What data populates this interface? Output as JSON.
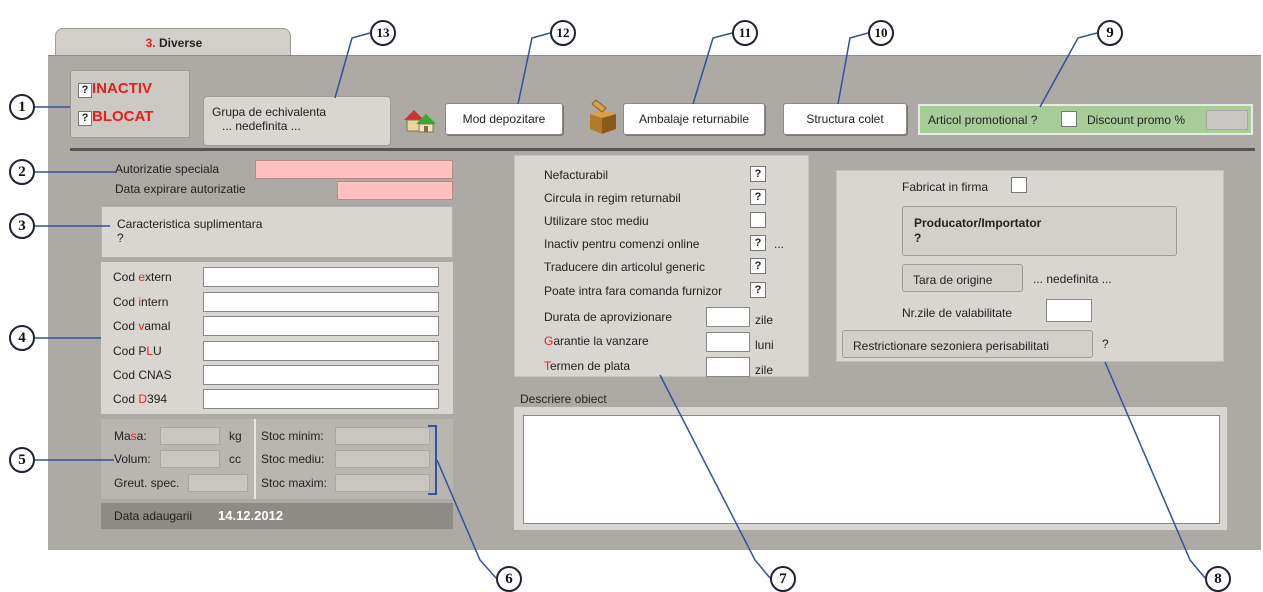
{
  "tab": {
    "num": "3.",
    "label": "Diverse"
  },
  "status": {
    "inactiv": "INACTIV",
    "blocat": "BLOCAT",
    "q": "?"
  },
  "grupa": {
    "line1": "Grupa de echivalenta",
    "line2": "... nedefinita ..."
  },
  "buttons": {
    "mod_depozitare": "Mod depozitare",
    "ambalaje": "Ambalaje returnabile",
    "structura": "Structura colet"
  },
  "promo": {
    "articol": "Articol promotional ?",
    "discount": "Discount promo %"
  },
  "autorizatie": {
    "speciala": "Autorizatie speciala",
    "data_expirare": "Data expirare autorizatie"
  },
  "caracteristica": {
    "label": "Caracteristica suplimentara",
    "value": "?"
  },
  "coduri": [
    {
      "pre": "Cod ",
      "red": "e",
      "post": "xtern"
    },
    {
      "pre": "Cod ",
      "red": "i",
      "post": "ntern"
    },
    {
      "pre": "Cod ",
      "red": "v",
      "post": "amal"
    },
    {
      "pre": "Cod P",
      "red": "L",
      "post": "U"
    },
    {
      "pre": "Cod CNAS",
      "red": "",
      "post": ""
    },
    {
      "pre": "Cod ",
      "red": "D",
      "post": "394"
    }
  ],
  "fizice": {
    "masa_pre": "Ma",
    "masa_red": "s",
    "masa_post": "a:",
    "kg": "kg",
    "volum": "Volum:",
    "cc": "cc",
    "greut": "Greut. spec."
  },
  "stoc": {
    "minim": "Stoc minim:",
    "mediu": "Stoc mediu:",
    "maxim": "Stoc maxim:"
  },
  "data_adaugarii": {
    "label": "Data adaugarii",
    "value": "14.12.2012"
  },
  "flags": [
    {
      "label": "Nefacturabil",
      "mark": "?"
    },
    {
      "label": "Circula in regim returnabil",
      "mark": "?"
    },
    {
      "label": "Utilizare stoc mediu",
      "mark": ""
    },
    {
      "label": "Inactiv pentru comenzi online",
      "mark": "?",
      "extra": "..."
    },
    {
      "label": "Traducere din articolul generic",
      "mark": "?"
    },
    {
      "label": "Poate intra fara comanda furnizor",
      "mark": "?"
    }
  ],
  "durate": {
    "aprov": "Durata de aprovizionare",
    "aprov_unit": "zile",
    "garantie_red": "G",
    "garantie": "arantie la vanzare",
    "garantie_unit": "luni",
    "termen_red": "T",
    "termen": "ermen de plata",
    "termen_unit": "zile"
  },
  "right": {
    "fabricat": "Fabricat in firma",
    "producator": "Producator/Importator",
    "producator_q": "?",
    "tara": "Tara de origine",
    "tara_value": "... nedefinita ...",
    "nr_zile": "Nr.zile de valabilitate",
    "restrictionare": "Restrictionare sezoniera perisabilitati",
    "restrictionare_q": "?"
  },
  "descriere": {
    "label": "Descriere obiect"
  },
  "callouts": [
    "1",
    "2",
    "3",
    "4",
    "5",
    "6",
    "7",
    "8",
    "9",
    "10",
    "11",
    "12",
    "13"
  ]
}
